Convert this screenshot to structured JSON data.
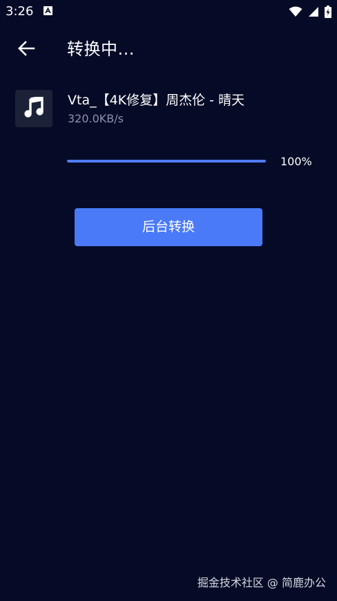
{
  "status_bar": {
    "time": "3:26",
    "icons": [
      "notification-a-icon",
      "wifi-icon",
      "signal-icon",
      "battery-charging-icon"
    ]
  },
  "app_bar": {
    "back_icon": "arrow-left-icon",
    "title": "转换中..."
  },
  "file": {
    "thumb_icon": "music-note-icon",
    "name": "Vta_【4K修复】周杰伦 - 晴天",
    "speed": "320.0KB/s"
  },
  "progress": {
    "value": 100,
    "label": "100%"
  },
  "actions": {
    "background_convert_label": "后台转换"
  },
  "watermark": {
    "text": "掘金技术社区 @ 简鹿办公"
  },
  "colors": {
    "background": "#050a26",
    "accent": "#4a7af8",
    "progress_fill": "#4f7cf6",
    "thumb_bg": "#1b2238",
    "secondary_text": "#8b93ab"
  }
}
